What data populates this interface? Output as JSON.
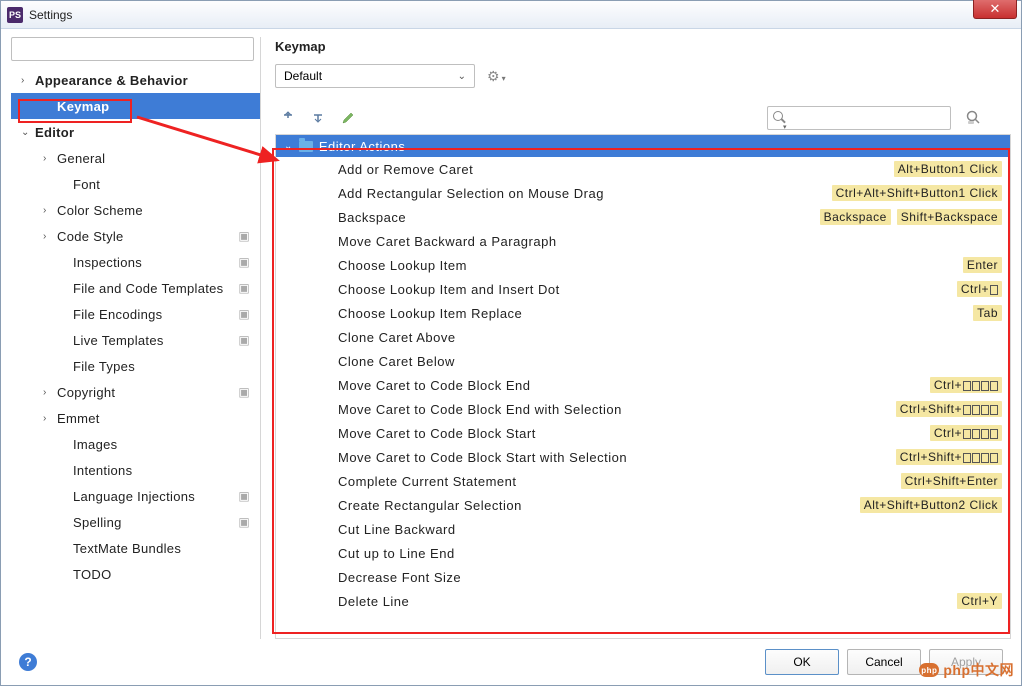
{
  "window": {
    "title": "Settings"
  },
  "sidebar": {
    "search_placeholder": "",
    "items": [
      {
        "label": "Appearance & Behavior",
        "level": 0,
        "arrow": "›",
        "bold": true
      },
      {
        "label": "Keymap",
        "level": 1,
        "arrow": "",
        "bold": true,
        "selected": true
      },
      {
        "label": "Editor",
        "level": 0,
        "arrow": "⌄",
        "bold": true
      },
      {
        "label": "General",
        "level": 1,
        "arrow": "›"
      },
      {
        "label": "Font",
        "level": 2,
        "arrow": ""
      },
      {
        "label": "Color Scheme",
        "level": 1,
        "arrow": "›"
      },
      {
        "label": "Code Style",
        "level": 1,
        "arrow": "›",
        "copy": true
      },
      {
        "label": "Inspections",
        "level": 2,
        "arrow": "",
        "copy": true
      },
      {
        "label": "File and Code Templates",
        "level": 2,
        "arrow": "",
        "copy": true
      },
      {
        "label": "File Encodings",
        "level": 2,
        "arrow": "",
        "copy": true
      },
      {
        "label": "Live Templates",
        "level": 2,
        "arrow": "",
        "copy": true
      },
      {
        "label": "File Types",
        "level": 2,
        "arrow": ""
      },
      {
        "label": "Copyright",
        "level": 1,
        "arrow": "›",
        "copy": true
      },
      {
        "label": "Emmet",
        "level": 1,
        "arrow": "›"
      },
      {
        "label": "Images",
        "level": 2,
        "arrow": ""
      },
      {
        "label": "Intentions",
        "level": 2,
        "arrow": ""
      },
      {
        "label": "Language Injections",
        "level": 2,
        "arrow": "",
        "copy": true
      },
      {
        "label": "Spelling",
        "level": 2,
        "arrow": "",
        "copy": true
      },
      {
        "label": "TextMate Bundles",
        "level": 2,
        "arrow": ""
      },
      {
        "label": "TODO",
        "level": 2,
        "arrow": ""
      }
    ]
  },
  "right": {
    "heading": "Keymap",
    "preset": "Default",
    "filter_placeholder": "",
    "group": "Editor Actions",
    "actions": [
      {
        "name": "Add or Remove Caret",
        "sc": [
          "Alt+Button1 Click"
        ]
      },
      {
        "name": "Add Rectangular Selection on Mouse Drag",
        "sc": [
          "Ctrl+Alt+Shift+Button1 Click"
        ]
      },
      {
        "name": "Backspace",
        "sc": [
          "Backspace",
          "Shift+Backspace"
        ]
      },
      {
        "name": "Move Caret Backward a Paragraph",
        "sc": []
      },
      {
        "name": "Choose Lookup Item",
        "sc": [
          "Enter"
        ]
      },
      {
        "name": "Choose Lookup Item and Insert Dot",
        "sc": [
          "Ctrl+",
          "_BOX1"
        ]
      },
      {
        "name": "Choose Lookup Item Replace",
        "sc": [
          "Tab"
        ]
      },
      {
        "name": "Clone Caret Above",
        "sc": []
      },
      {
        "name": "Clone Caret Below",
        "sc": []
      },
      {
        "name": "Move Caret to Code Block End",
        "sc": [
          "Ctrl+",
          "_BOX4"
        ]
      },
      {
        "name": "Move Caret to Code Block End with Selection",
        "sc": [
          "Ctrl+Shift+",
          "_BOX4"
        ]
      },
      {
        "name": "Move Caret to Code Block Start",
        "sc": [
          "Ctrl+",
          "_BOX4"
        ]
      },
      {
        "name": "Move Caret to Code Block Start with Selection",
        "sc": [
          "Ctrl+Shift+",
          "_BOX4"
        ]
      },
      {
        "name": "Complete Current Statement",
        "sc": [
          "Ctrl+Shift+Enter"
        ]
      },
      {
        "name": "Create Rectangular Selection",
        "sc": [
          "Alt+Shift+Button2 Click"
        ]
      },
      {
        "name": "Cut Line Backward",
        "sc": []
      },
      {
        "name": "Cut up to Line End",
        "sc": []
      },
      {
        "name": "Decrease Font Size",
        "sc": []
      },
      {
        "name": "Delete Line",
        "sc": [
          "Ctrl+Y"
        ]
      }
    ]
  },
  "buttons": {
    "ok": "OK",
    "cancel": "Cancel",
    "apply": "Apply"
  },
  "watermark": "php中文网"
}
